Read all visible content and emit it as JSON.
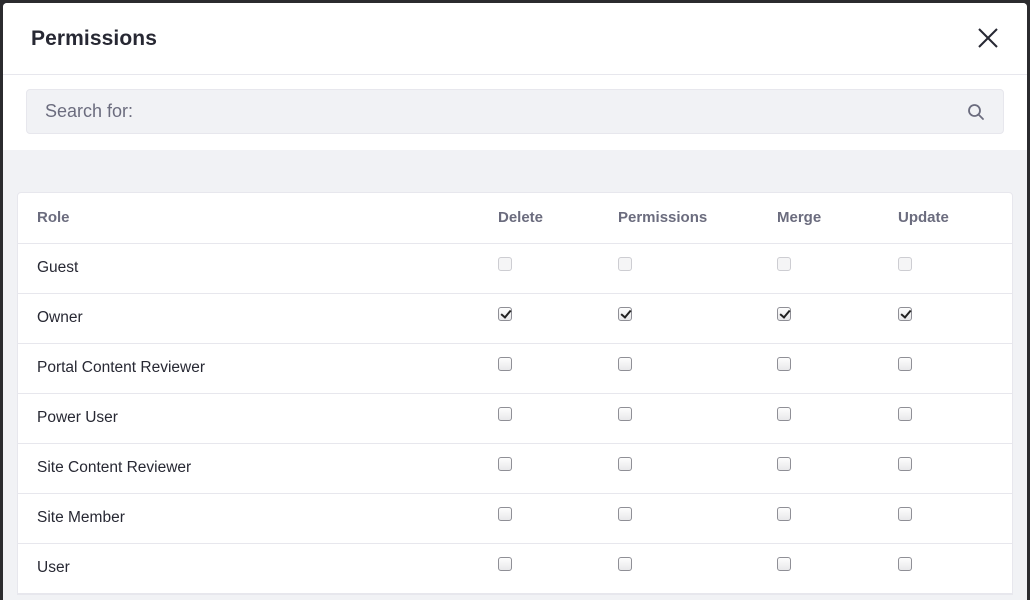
{
  "modal": {
    "title": "Permissions"
  },
  "search": {
    "placeholder": "Search for:",
    "value": ""
  },
  "table": {
    "headers": {
      "role": "Role",
      "delete": "Delete",
      "permissions": "Permissions",
      "merge": "Merge",
      "update": "Update"
    },
    "rows": [
      {
        "role": "Guest",
        "delete": false,
        "permissions": false,
        "merge": false,
        "update": false,
        "disabled": true
      },
      {
        "role": "Owner",
        "delete": true,
        "permissions": true,
        "merge": true,
        "update": true,
        "disabled": false
      },
      {
        "role": "Portal Content Reviewer",
        "delete": false,
        "permissions": false,
        "merge": false,
        "update": false,
        "disabled": false
      },
      {
        "role": "Power User",
        "delete": false,
        "permissions": false,
        "merge": false,
        "update": false,
        "disabled": false
      },
      {
        "role": "Site Content Reviewer",
        "delete": false,
        "permissions": false,
        "merge": false,
        "update": false,
        "disabled": false
      },
      {
        "role": "Site Member",
        "delete": false,
        "permissions": false,
        "merge": false,
        "update": false,
        "disabled": false
      },
      {
        "role": "User",
        "delete": false,
        "permissions": false,
        "merge": false,
        "update": false,
        "disabled": false
      }
    ]
  },
  "icons": {
    "close": "close-icon",
    "search": "search-icon"
  },
  "colors": {
    "header_text": "#272833",
    "column_header_text": "#6b6c7e",
    "border": "#e7e7ed",
    "body_background": "#f1f2f5"
  }
}
